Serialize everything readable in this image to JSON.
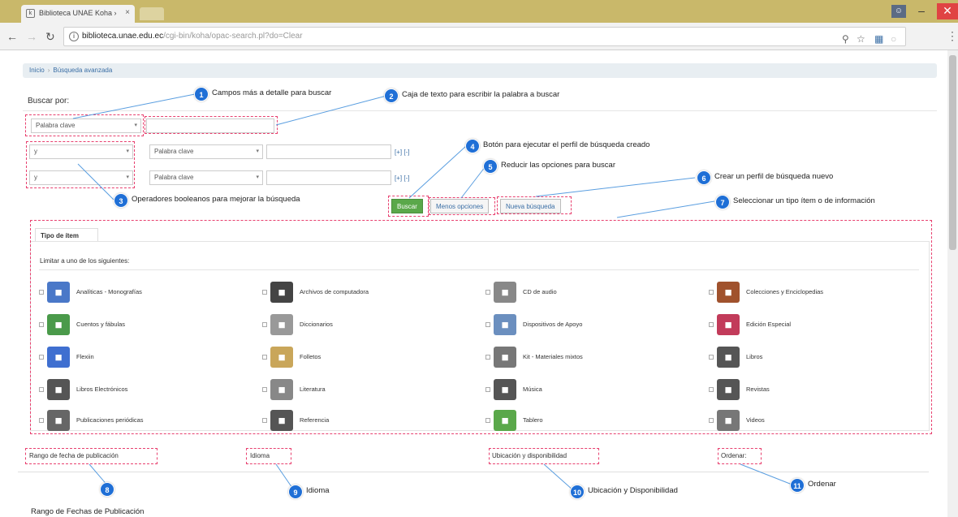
{
  "browser": {
    "tab_title": "Biblioteca UNAE Koha › ",
    "tab_close": "×",
    "user_initial": "",
    "url_host": "biblioteca.unae.edu.ec",
    "url_path": "/cgi-bin/koha/opac-search.pl?do=Clear"
  },
  "breadcrumb": {
    "home": "Inicio",
    "current": "Búsqueda avanzada"
  },
  "search": {
    "buscar_por": "Buscar por:",
    "row1_field": "Palabra clave",
    "row2_operator": "y",
    "row2_field": "Palabra clave",
    "row3_operator": "y",
    "row3_field": "Palabra clave",
    "plusminus": "[+] [-]",
    "btn_buscar": "Buscar",
    "btn_menos_opciones": "Menos opciones",
    "btn_nueva_busqueda": "Nueva búsqueda"
  },
  "item_types": {
    "tab_label": "Tipo de ítem",
    "limit_label": "Limitar a uno de los siguientes:",
    "items": [
      {
        "label": "Analíticas - Monografías",
        "icon": "books-icon",
        "color": "#4a78c8"
      },
      {
        "label": "Archivos de computadora",
        "icon": "floppy-icon",
        "color": "#444444"
      },
      {
        "label": "CD de audio",
        "icon": "cd-icon",
        "color": "#888888"
      },
      {
        "label": "Colecciones y Enciclopedias",
        "icon": "box-icon",
        "color": "#a0522d"
      },
      {
        "label": "Cuentos y fábulas",
        "icon": "storybook-icon",
        "color": "#4a9a4a"
      },
      {
        "label": "Diccionarios",
        "icon": "dictionary-icon",
        "color": "#999999"
      },
      {
        "label": "Dispositivos de Apoyo",
        "icon": "device-icon",
        "color": "#6b8fbf"
      },
      {
        "label": "Edición Especial",
        "icon": "special-edition-icon",
        "color": "#c23b5a"
      },
      {
        "label": "Flexiin",
        "icon": "cube-icon",
        "color": "#3f6fd0"
      },
      {
        "label": "Folletos",
        "icon": "folleto-icon",
        "color": "#c9a65a"
      },
      {
        "label": "Kit - Materiales mixtos",
        "icon": "kit-icon",
        "color": "#777777"
      },
      {
        "label": "Libros",
        "icon": "book-icon",
        "color": "#555555"
      },
      {
        "label": "Libros Electrónicos",
        "icon": "ebook-icon",
        "color": "#555555"
      },
      {
        "label": "Literatura",
        "icon": "literature-icon",
        "color": "#888888"
      },
      {
        "label": "Música",
        "icon": "music-icon",
        "color": "#555555"
      },
      {
        "label": "Revistas",
        "icon": "magazine-icon",
        "color": "#555555"
      },
      {
        "label": "Publicaciones periódicas",
        "icon": "periodicals-icon",
        "color": "#666666"
      },
      {
        "label": "Referencia",
        "icon": "reference-icon",
        "color": "#555555"
      },
      {
        "label": "Tablero",
        "icon": "board-icon",
        "color": "#5aa84a"
      },
      {
        "label": "Videos",
        "icon": "video-icon",
        "color": "#777777"
      }
    ]
  },
  "footer_sections": {
    "rango_fecha": "Rango de fecha de publicación",
    "idioma": "Idioma",
    "ubicacion": "Ubicación y disponibilidad",
    "ordenar": "Ordenar:"
  },
  "annotations": [
    {
      "num": "1",
      "text": "Campos más a detalle para buscar"
    },
    {
      "num": "2",
      "text": "Caja de texto para escribir la palabra a buscar"
    },
    {
      "num": "3",
      "text": "Operadores booleanos para mejorar la búsqueda"
    },
    {
      "num": "4",
      "text": "Botón para ejecutar el perfil de búsqueda creado"
    },
    {
      "num": "5",
      "text": "Reducir las opciones para buscar"
    },
    {
      "num": "6",
      "text": "Crear un perfil de búsqueda nuevo"
    },
    {
      "num": "7",
      "text": "Seleccionar un tipo ítem o de información"
    },
    {
      "num": "8",
      "text": "Rango de Fechas de Publicación"
    },
    {
      "num": "9",
      "text": "Idioma"
    },
    {
      "num": "10",
      "text": "Ubicación y Disponibilidad"
    },
    {
      "num": "11",
      "text": "Ordenar"
    }
  ],
  "colors": {
    "annotation_badge": "#1f6fd6",
    "highlight_box": "#e8406f",
    "buscar_button": "#5aa84a"
  }
}
